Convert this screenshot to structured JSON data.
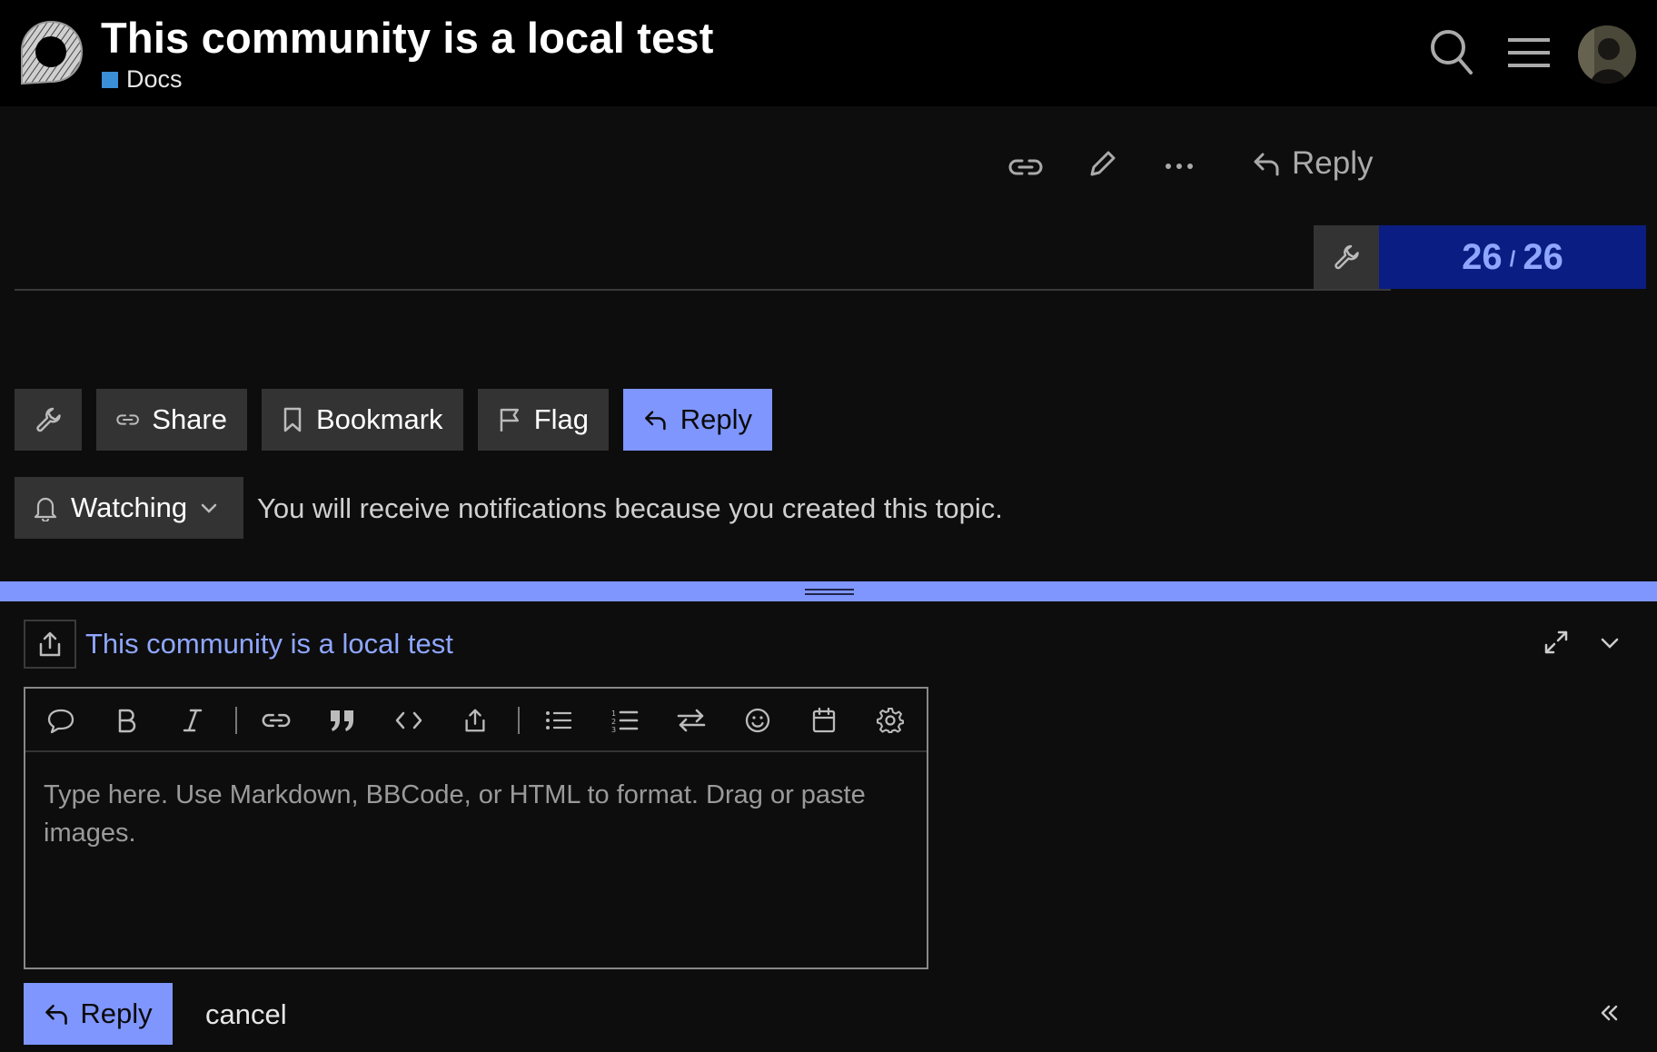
{
  "header": {
    "title": "This community is a local test",
    "category": {
      "label": "Docs",
      "color": "#3a8fd6"
    },
    "icons": [
      "search-icon",
      "hamburger-menu-icon"
    ]
  },
  "post_actions": {
    "icons": [
      "link-icon",
      "pencil-icon",
      "ellipsis-icon"
    ],
    "reply_label": "Reply"
  },
  "progress": {
    "current": "26",
    "separator": "/",
    "total": "26"
  },
  "topic_footer": {
    "share_label": "Share",
    "bookmark_label": "Bookmark",
    "flag_label": "Flag",
    "reply_label": "Reply",
    "watching_label": "Watching",
    "watching_message": "You will receive notifications because you created this topic."
  },
  "composer": {
    "title": "This community is a local test",
    "placeholder": "Type here. Use Markdown, BBCode, or HTML to format. Drag or paste images.",
    "toolbar": [
      "comment-icon",
      "bold-icon",
      "italic-icon",
      "link-icon",
      "quote-icon",
      "code-icon",
      "upload-icon",
      "bullet-list-icon",
      "numbered-list-icon",
      "rtl-toggle-icon",
      "emoji-icon",
      "calendar-icon",
      "gear-icon"
    ],
    "submit_label": "Reply",
    "cancel_label": "cancel"
  },
  "colors": {
    "accent": "#7f96ff",
    "progress_bg": "#0a1d82",
    "header_bg": "#000000",
    "page_bg": "#0d0d0d"
  }
}
